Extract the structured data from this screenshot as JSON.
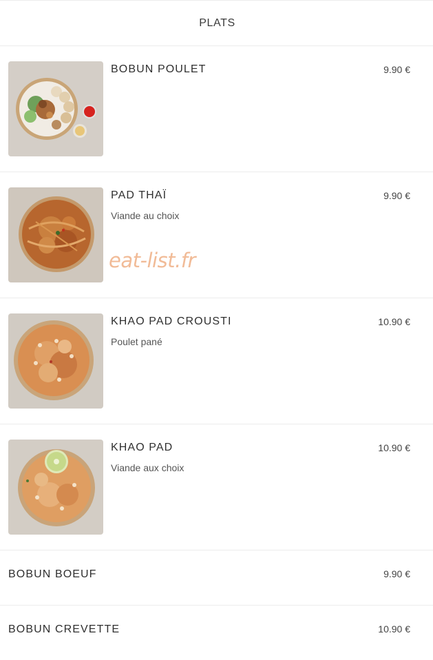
{
  "header": {
    "title": "PLATS"
  },
  "items": [
    {
      "name": "BOBUN POULET",
      "description": "",
      "price": "9.90 €",
      "image": "bobun-bowl-image"
    },
    {
      "name": "PAD THAÏ",
      "description": "Viande au choix",
      "price": "9.90 €",
      "image": "pad-thai-bowl-image"
    },
    {
      "name": "KHAO PAD CROUSTI",
      "description": "Poulet pané",
      "price": "10.90 €",
      "image": "fried-rice-bowl-image"
    },
    {
      "name": "KHAO PAD",
      "description": "Viande aux choix",
      "price": "10.90 €",
      "image": "fried-rice-lime-bowl-image"
    },
    {
      "name": "BOBUN BOEUF",
      "description": "",
      "price": "9.90 €"
    },
    {
      "name": "BOBUN CREVETTE",
      "description": "",
      "price": "10.90 €"
    }
  ],
  "watermark": "eat-list.fr",
  "colors": {
    "divider": "#ececec",
    "watermark": "#f0b48c",
    "text": "#333333"
  }
}
